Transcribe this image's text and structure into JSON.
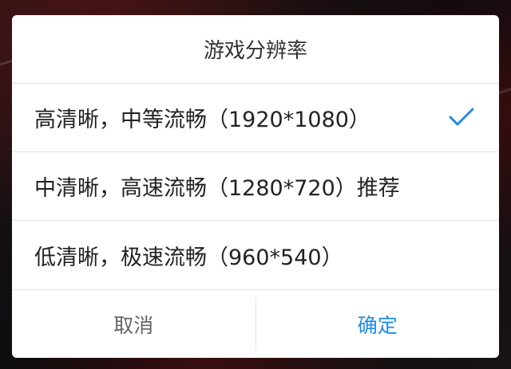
{
  "dialog": {
    "title": "游戏分辨率",
    "options": [
      {
        "label": "高清晰，中等流畅（1920*1080）",
        "selected": true
      },
      {
        "label": "中清晰，高速流畅（1280*720）推荐",
        "selected": false
      },
      {
        "label": "低清晰，极速流畅（960*540）",
        "selected": false
      }
    ],
    "cancel_label": "取消",
    "confirm_label": "确定"
  },
  "colors": {
    "accent": "#1e8ce6",
    "cancel_text": "#666666",
    "option_text": "#222222"
  },
  "icons": {
    "selected_mark": "checkmark-icon"
  }
}
